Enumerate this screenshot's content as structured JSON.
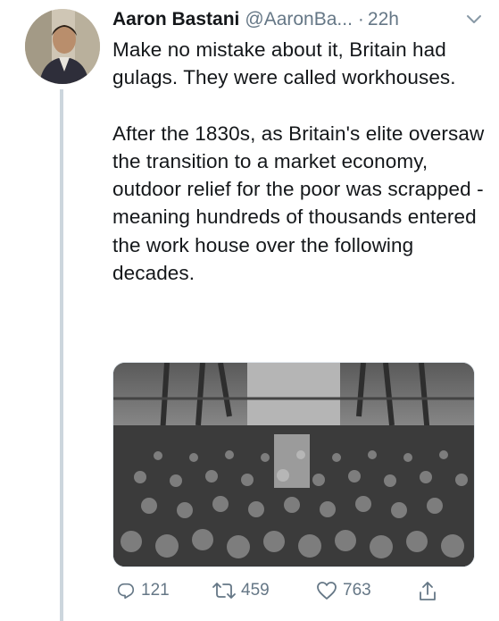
{
  "tweet": {
    "author_name": "Aaron Bastani",
    "handle": "@AaronBa...",
    "separator": "·",
    "time": "22h",
    "paragraphs": [
      "Make no mistake about it, Britain had gulags. They were called workhouses.",
      "After the 1830s, as Britain's elite oversaw the transition to a market economy, outdoor relief for the poor was scrapped - meaning hundreds of thousands entered the work house over the following decades."
    ],
    "media": {
      "kind": "black-and-white photo",
      "icon": "photo"
    }
  },
  "actions": {
    "reply_count": "121",
    "retweet_count": "459",
    "like_count": "763"
  },
  "colors": {
    "text": "#14171a",
    "secondary": "#657786",
    "thread_line": "#ccd6dd"
  },
  "icons": [
    "reply-icon",
    "retweet-icon",
    "like-icon",
    "share-icon",
    "chevron-down-icon"
  ]
}
